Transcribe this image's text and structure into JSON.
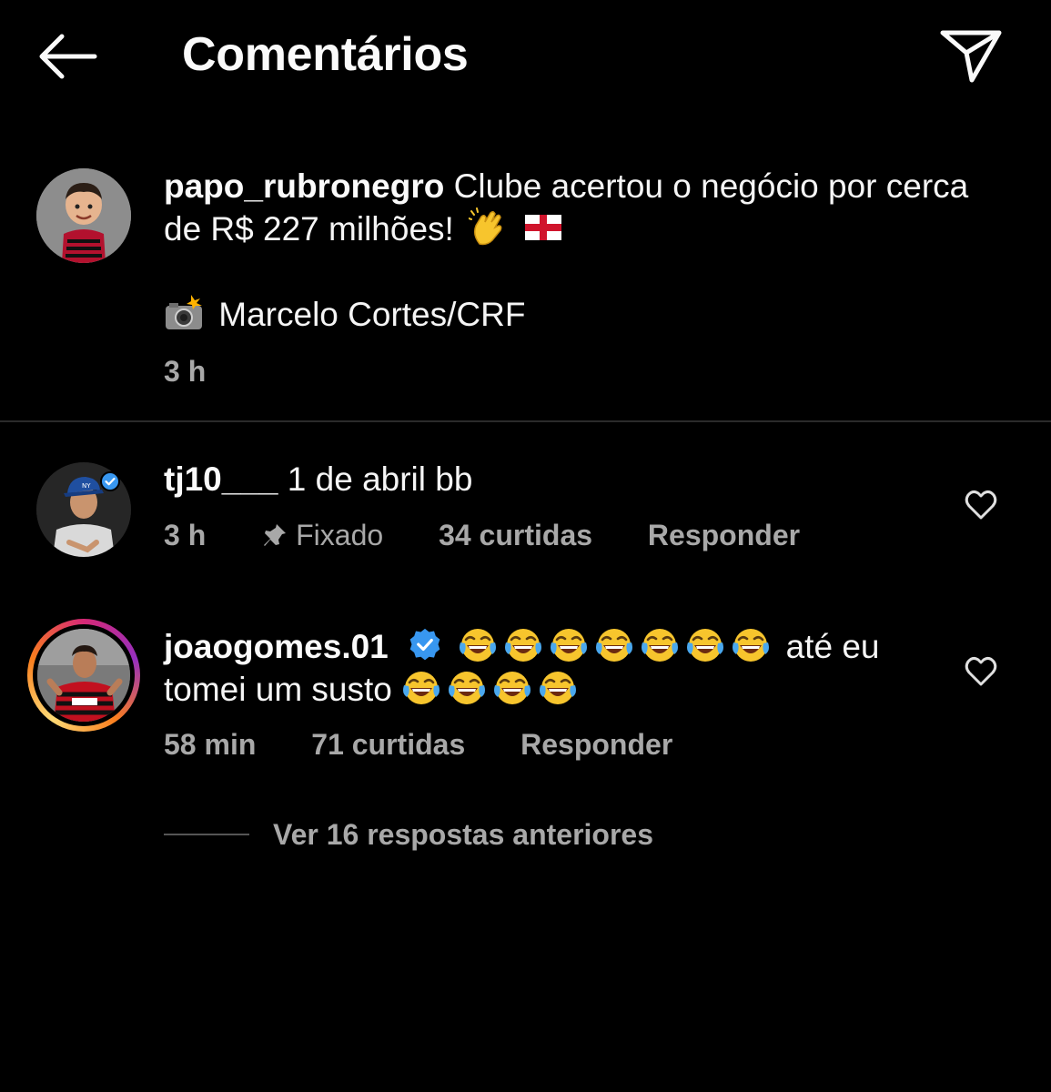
{
  "header": {
    "title": "Comentários",
    "back_icon": "arrow-left-icon",
    "share_icon": "paper-plane-icon"
  },
  "caption": {
    "username": "papo_rubronegro",
    "text": "Clube acertou o negócio por cerca de R$ 227 milhões!",
    "emojis": [
      "clapping-hands",
      "england-flag"
    ],
    "credit_emoji": "camera-flash",
    "credit": "Marcelo Cortes/CRF",
    "time": "3 h"
  },
  "comments": [
    {
      "username": "tj10___",
      "verified": true,
      "text": "1 de abril bb",
      "time": "3 h",
      "pinned_label": "Fixado",
      "likes": "34 curtidas",
      "reply_label": "Responder"
    },
    {
      "username": "joaogomes.01",
      "verified": true,
      "has_story_ring": true,
      "emoji_run_1": 7,
      "text_1": "até eu",
      "text_2": "tomei um susto",
      "emoji_run_2": 4,
      "time": "58 min",
      "likes": "71 curtidas",
      "reply_label": "Responder"
    }
  ],
  "view_replies": "Ver 16 respostas anteriores",
  "colors": {
    "background": "#000000",
    "primary_text": "#f5f5f5",
    "secondary_text": "#a8a8a8",
    "verified_blue": "#3897f0",
    "story_ring": [
      "#feda75",
      "#fa7e1e",
      "#d62976",
      "#962fbf"
    ]
  }
}
